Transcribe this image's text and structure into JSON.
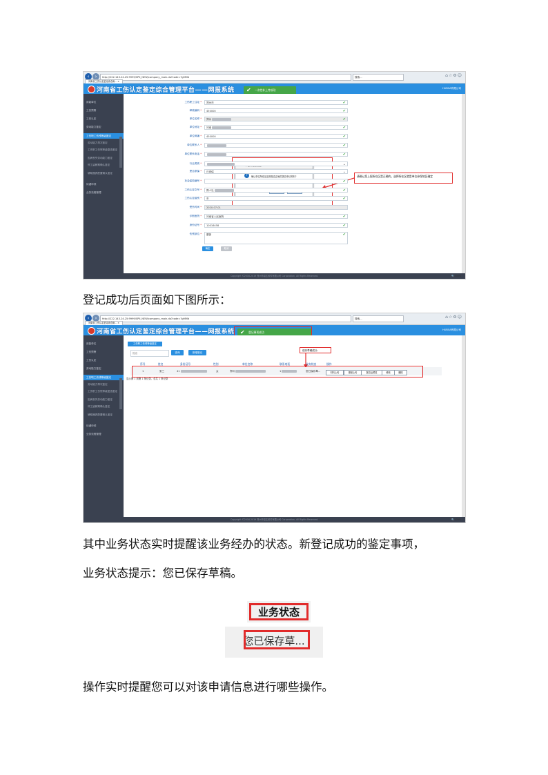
{
  "paragraphs": {
    "p1": "登记成功后页面如下图所示：",
    "p2": "其中业务状态实时提醒该业务经办的状态。新登记成功的鉴定事项，",
    "p3": "业务状态提示：您已保存草稿。",
    "p4": "操作实时提醒您可以对该申请信息进行哪些操作。"
  },
  "browser": {
    "url": "http://222.143.24.25:9999/SPII_NEW/company_main.do?code=?gMMd",
    "search": "搜索...",
    "tab": "河南省工伤认定鉴定综合管... ×"
  },
  "app": {
    "title": "河南省工伤认定鉴定综合管理平台——网报系统",
    "company": "HUBSA有限公司",
    "footer": "Copyright ©2016-2019 郑州市易达软件有限公司 Corporation, All Rights Reserved.",
    "zoom": "100%"
  },
  "sidebar": {
    "items": [
      "用能单位",
      "工伤预警",
      "工伤认定",
      "劳动能力鉴定",
      "工伤职工伤残等级鉴定",
      "劳动能力再次鉴定",
      "工伤职工伤残等级复查鉴定",
      "因病丧失劳动能力鉴定",
      "停工留薪期确认鉴定",
      "辅助器具配置确认鉴定",
      "待遇申领",
      "业务流程管理"
    ]
  },
  "shot1": {
    "toast": "一次性补上传成功",
    "fields": [
      {
        "label": "工伤职工住址",
        "value": "郑州市",
        "grey": false
      },
      {
        "label": "邮政编码",
        "value": "450000",
        "grey": false
      },
      {
        "label": "单位名称",
        "value": "郑州",
        "grey": true
      },
      {
        "label": "单位地址",
        "value": "河南",
        "grey": false
      },
      {
        "label": "单位邮编",
        "value": "450000",
        "grey": false
      },
      {
        "label": "单位联系人",
        "value": "",
        "grey": false
      },
      {
        "label": "单位联系电话",
        "value": "",
        "grey": false
      },
      {
        "label": "行业类别",
        "value": "",
        "grey": false
      },
      {
        "label": "是否参保",
        "value": "已参保",
        "grey": false
      },
      {
        "label": "社会保险编号",
        "value": "",
        "grey": false
      },
      {
        "label": "工伤认定文号",
        "value": "豫人社",
        "grey": false
      },
      {
        "label": "工伤认定级别",
        "value": "市",
        "grey": false
      },
      {
        "label": "受伤时间",
        "value": "2020-07-01",
        "grey": true
      },
      {
        "label": "诊断医院",
        "value": "河南省人民医院",
        "grey": false
      },
      {
        "label": "身份证号",
        "value": "10016458",
        "grey": false
      },
      {
        "label": "伤残部位",
        "value": "腰部",
        "grey": false
      }
    ],
    "buttons": {
      "ok": "确定",
      "cancel": "取消"
    },
    "dialog": {
      "title": "单位所在区提醒",
      "message": "确认单位所在区选择是否正确并提交申请材料?",
      "ok": "确定",
      "cancel": "取消"
    },
    "note": "请确认您上报所在区是正确的，选择所在区就是单位参保地区确定"
  },
  "shot2": {
    "toast": "登记事项成功",
    "subtab": "工伤职工伤残等级鉴定",
    "search_placeholder": "姓名",
    "search_btn": "查询",
    "add_btn": "新增登记",
    "note": "保存草稿成功",
    "columns": [
      "序号",
      "姓名",
      "身份证号",
      "性别",
      "单位名称",
      "联系电话",
      "业务状态",
      "操作"
    ],
    "row": {
      "no": "1",
      "name": "张三",
      "id": "41",
      "gender": "女",
      "unit": "郑州",
      "phone": "1",
      "status": "您已保存草..."
    },
    "ops": [
      "材料上传",
      "视频上传",
      "提交后预览",
      "修改",
      "删除"
    ],
    "pager": "显示第 1 到第 1 条记录，总共 1 条记录"
  },
  "crops": {
    "status_header": "业务状态",
    "status_value": "您已保存草..."
  }
}
